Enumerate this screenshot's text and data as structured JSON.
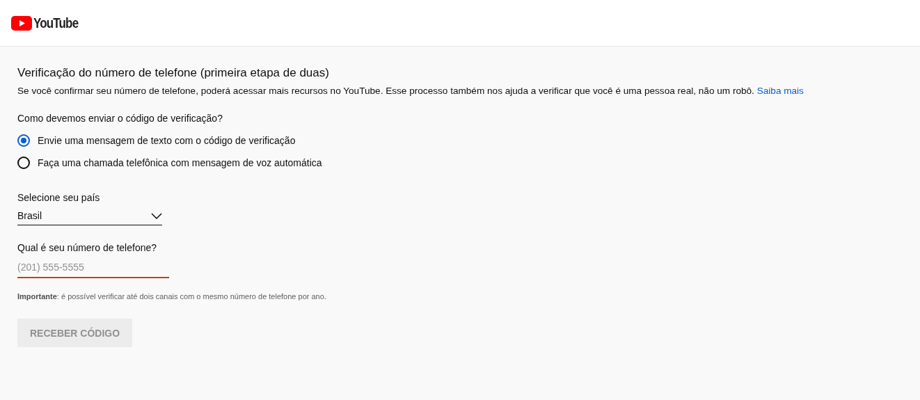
{
  "header": {
    "logo_text": "YouTube"
  },
  "form": {
    "title": "Verificação do número de telefone (primeira etapa de duas)",
    "description": "Se você confirmar seu número de telefone, poderá acessar mais recursos no YouTube. Esse processo também nos ajuda a verificar que você é uma pessoa real, não um robô.",
    "learn_more_link": "Saiba mais",
    "method_question": "Como devemos enviar o código de verificação?",
    "methods": [
      {
        "label": "Envie uma mensagem de texto com o código de verificação",
        "selected": true
      },
      {
        "label": "Faça uma chamada telefônica com mensagem de voz automática",
        "selected": false
      }
    ],
    "country_label": "Selecione seu país",
    "country_value": "Brasil",
    "phone_label": "Qual é seu número de telefone?",
    "phone_field": {
      "placeholder": "(201) 555-5555",
      "focused": true
    },
    "note": "**Importante**: é possível verificar até dois canais com o mesmo número de telefone por ano.",
    "submit_button": {
      "label": "RECEBER CÓDIGO",
      "disabled": true
    }
  }
}
